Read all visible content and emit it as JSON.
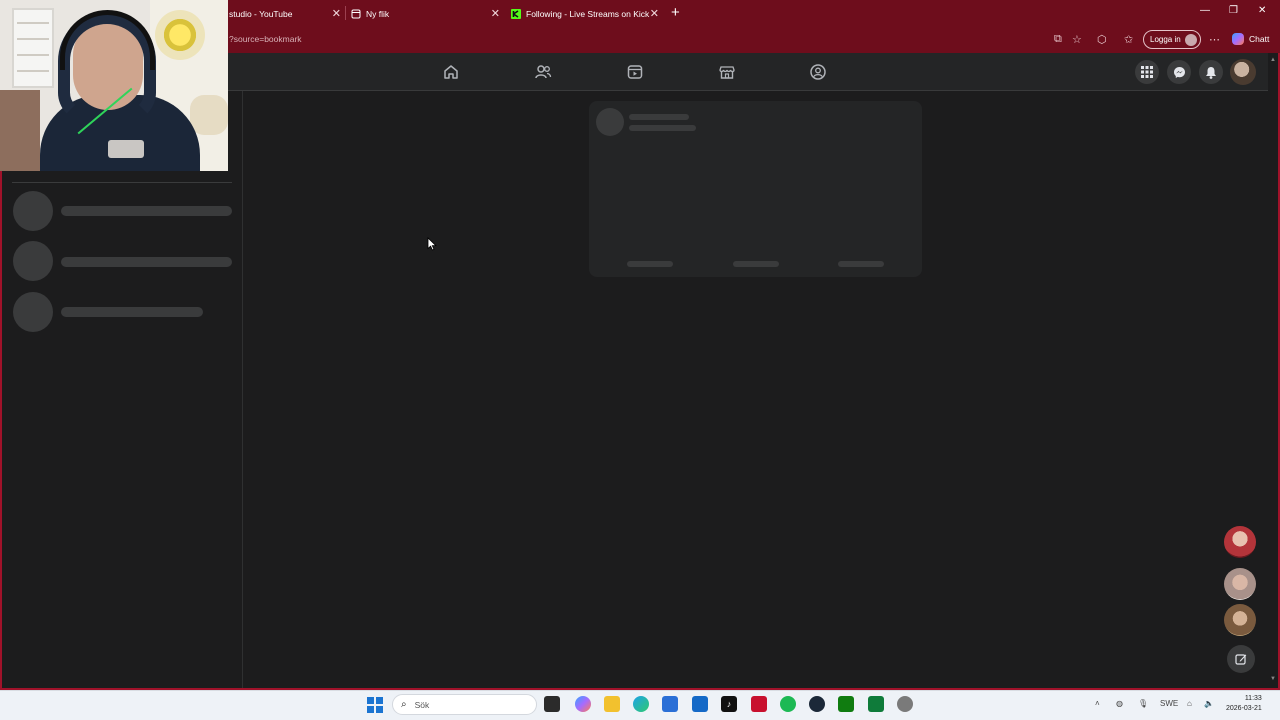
{
  "browser": {
    "tabs": [
      {
        "title": "studio - YouTube",
        "icon": "youtube-icon"
      },
      {
        "title": "Ny flik",
        "icon": "page-icon"
      },
      {
        "title": "Following - Live Streams on Kick",
        "icon": "kick-icon"
      }
    ],
    "url": "?source=bookmark",
    "login_label": "Logga in",
    "chat_label": "Chatt"
  },
  "facebook": {
    "nav": [
      "home-icon",
      "friends-icon",
      "video-icon",
      "marketplace-icon",
      "groups-icon"
    ],
    "header_buttons": [
      "menu-grid-icon",
      "messenger-icon",
      "notifications-icon"
    ],
    "loading": true
  },
  "taskbar": {
    "search_placeholder": "Sök",
    "apps": [
      "file-explorer-icon",
      "copilot-icon",
      "folder-icon",
      "edge-icon",
      "store-icon",
      "outlook-icon",
      "tiktok-icon",
      "tidal-icon",
      "spotify-icon",
      "steam-icon",
      "xbox-icon",
      "app-icon",
      "settings-icon"
    ],
    "language": "SWE",
    "time": "11:33",
    "date": "2026-03-21"
  },
  "colors": {
    "chrome": "#6e0d1c",
    "frame": "#a0122a",
    "background": "#1c1c1d",
    "skeleton": "#3a3b3c"
  }
}
